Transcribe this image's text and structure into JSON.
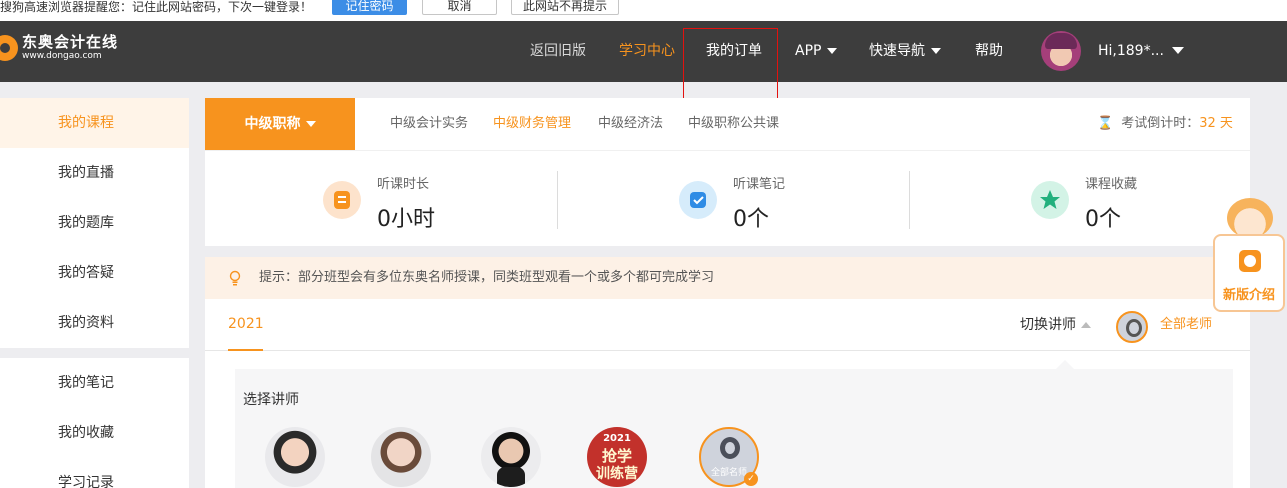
{
  "password_bar": {
    "message": "搜狗高速浏览器提醒您：记住此网站密码，下次一键登录！",
    "remember_label": "记住密码",
    "cancel_label": "取消",
    "never_label": "此网站不再提示"
  },
  "header": {
    "logo_cn": "东奥会计在线",
    "logo_en": "www.dongao.com",
    "nav": [
      {
        "label": "返回旧版"
      },
      {
        "label": "学习中心"
      },
      {
        "label": "我的订单"
      },
      {
        "label": "APP"
      },
      {
        "label": "快速导航"
      },
      {
        "label": "帮助"
      }
    ],
    "user_greeting": "Hi,189*..."
  },
  "sidebar": {
    "group1": [
      {
        "label": "我的课程"
      },
      {
        "label": "我的直播"
      },
      {
        "label": "我的题库"
      },
      {
        "label": "我的答疑"
      },
      {
        "label": "我的资料"
      }
    ],
    "group2": [
      {
        "label": "我的笔记"
      },
      {
        "label": "我的收藏"
      },
      {
        "label": "学习记录"
      }
    ]
  },
  "main": {
    "level_label": "中级职称",
    "subjects": [
      {
        "label": "中级会计实务"
      },
      {
        "label": "中级财务管理"
      },
      {
        "label": "中级经济法"
      },
      {
        "label": "中级职称公共课"
      }
    ],
    "countdown_label": "考试倒计时：",
    "countdown_value": "32",
    "countdown_unit": "天",
    "stats": [
      {
        "label": "听课时长",
        "value": "0小时"
      },
      {
        "label": "听课笔记",
        "value": "0个"
      },
      {
        "label": "课程收藏",
        "value": "0个"
      }
    ],
    "tip": "提示：部分班型会有多位东奥名师授课，同类班型观看一个或多个都可完成学习",
    "year": "2021",
    "switch_label": "切换讲师",
    "all_teachers_label": "全部老师",
    "select_teacher_title": "选择讲师",
    "promo_year": "2021",
    "promo_line1": "抢学",
    "promo_line2": "训练营",
    "all_famous_label": "全部名师"
  },
  "float_widget": {
    "label": "新版介绍"
  },
  "colors": {
    "accent": "#f7931e",
    "nav_bg": "#3d3d3d",
    "highlight_box": "#e3120f"
  }
}
